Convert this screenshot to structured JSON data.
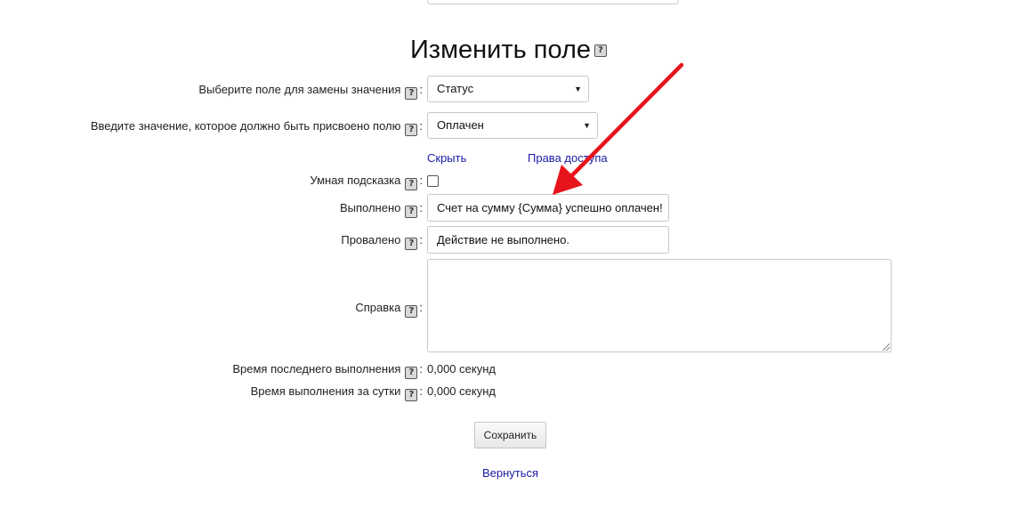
{
  "page": {
    "title": "Изменить поле",
    "help_glyph": "?"
  },
  "form": {
    "field_select": {
      "label": "Выберите поле для замены значения",
      "value": "Статус"
    },
    "value_select": {
      "label": "Введите значение, которое должно быть присвоено полю",
      "value": "Оплачен"
    },
    "links": {
      "hide": "Скрыть",
      "access_rights": "Права доступа"
    },
    "smart_hint": {
      "label": "Умная подсказка",
      "checked": false
    },
    "completed": {
      "label": "Выполнено",
      "value": "Счет на сумму {Сумма} успешно оплачен!"
    },
    "failed": {
      "label": "Провалено",
      "value": "Действие не выполнено."
    },
    "help": {
      "label": "Справка",
      "value": ""
    },
    "last_run_time": {
      "label": "Время последнего выполнения",
      "value": "0,000 секунд"
    },
    "daily_run_time": {
      "label": "Время выполнения за сутки",
      "value": "0,000 секунд"
    },
    "save_button": "Сохранить",
    "back_link": "Вернуться"
  },
  "colors": {
    "link": "#1a1aa6",
    "annotation_arrow": "#e8141b"
  }
}
